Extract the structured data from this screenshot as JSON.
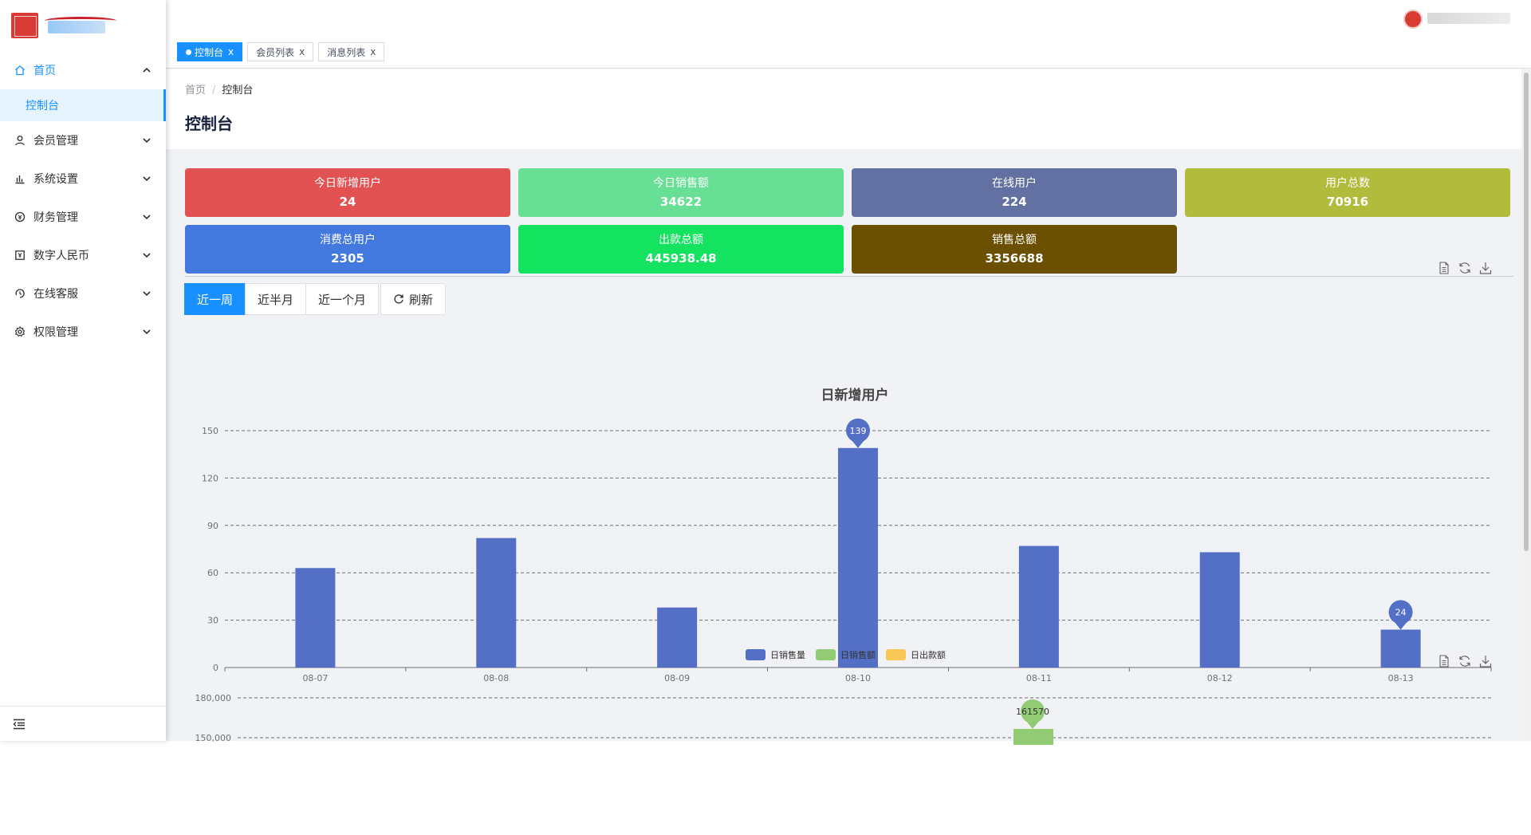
{
  "sidebar": {
    "menu": [
      {
        "label": "首页",
        "icon": "home-icon",
        "expanded": true
      },
      {
        "label": "会员管理",
        "icon": "user-icon"
      },
      {
        "label": "系统设置",
        "icon": "bar-chart-icon"
      },
      {
        "label": "财务管理",
        "icon": "finance-icon"
      },
      {
        "label": "数字人民币",
        "icon": "currency-icon"
      },
      {
        "label": "在线客服",
        "icon": "service-icon"
      },
      {
        "label": "权限管理",
        "icon": "gear-icon"
      }
    ],
    "submenu_active": "控制台"
  },
  "tabs": [
    {
      "label": "控制台",
      "active": true
    },
    {
      "label": "会员列表"
    },
    {
      "label": "消息列表"
    }
  ],
  "tab_close": "x",
  "breadcrumb": {
    "home": "首页",
    "sep": "/",
    "current": "控制台"
  },
  "page_title": "控制台",
  "stats": [
    {
      "label": "今日新增用户",
      "value": "24",
      "color": "#e25252"
    },
    {
      "label": "今日销售额",
      "value": "34622",
      "color": "#67df95"
    },
    {
      "label": "在线用户",
      "value": "224",
      "color": "#6271a1"
    },
    {
      "label": "用户总数",
      "value": "70916",
      "color": "#b1bb3c"
    },
    {
      "label": "消费总用户",
      "value": "2305",
      "color": "#4378df"
    },
    {
      "label": "出款总额",
      "value": "445938.48",
      "color": "#13e35f"
    },
    {
      "label": "销售总额",
      "value": "3356688",
      "color": "#6a5000"
    }
  ],
  "range_buttons": [
    "近一周",
    "近半月",
    "近一个月"
  ],
  "refresh_label": "刷新",
  "colors": {
    "accent": "#1890ff",
    "bar": "#5470c6",
    "green": "#91cc75",
    "yellow": "#fac858"
  },
  "chart_data": [
    {
      "type": "bar",
      "title": "日新增用户",
      "categories": [
        "08-07",
        "08-08",
        "08-09",
        "08-10",
        "08-11",
        "08-12",
        "08-13"
      ],
      "values": [
        63,
        82,
        38,
        139,
        77,
        73,
        24
      ],
      "ylim": [
        0,
        150
      ],
      "yticks": [
        0,
        30,
        60,
        90,
        120,
        150
      ],
      "markers": {
        "max": 139,
        "min": 24
      },
      "grid": true
    },
    {
      "type": "bar",
      "series": [
        {
          "name": "日销售量",
          "color": "#5470c6"
        },
        {
          "name": "日销售额",
          "color": "#91cc75"
        },
        {
          "name": "日出款额",
          "color": "#fac858"
        }
      ],
      "yticks_visible": [
        "180,000",
        "150,000"
      ],
      "markers": {
        "max": 161570
      },
      "legend": "top-center",
      "grid": true
    }
  ]
}
